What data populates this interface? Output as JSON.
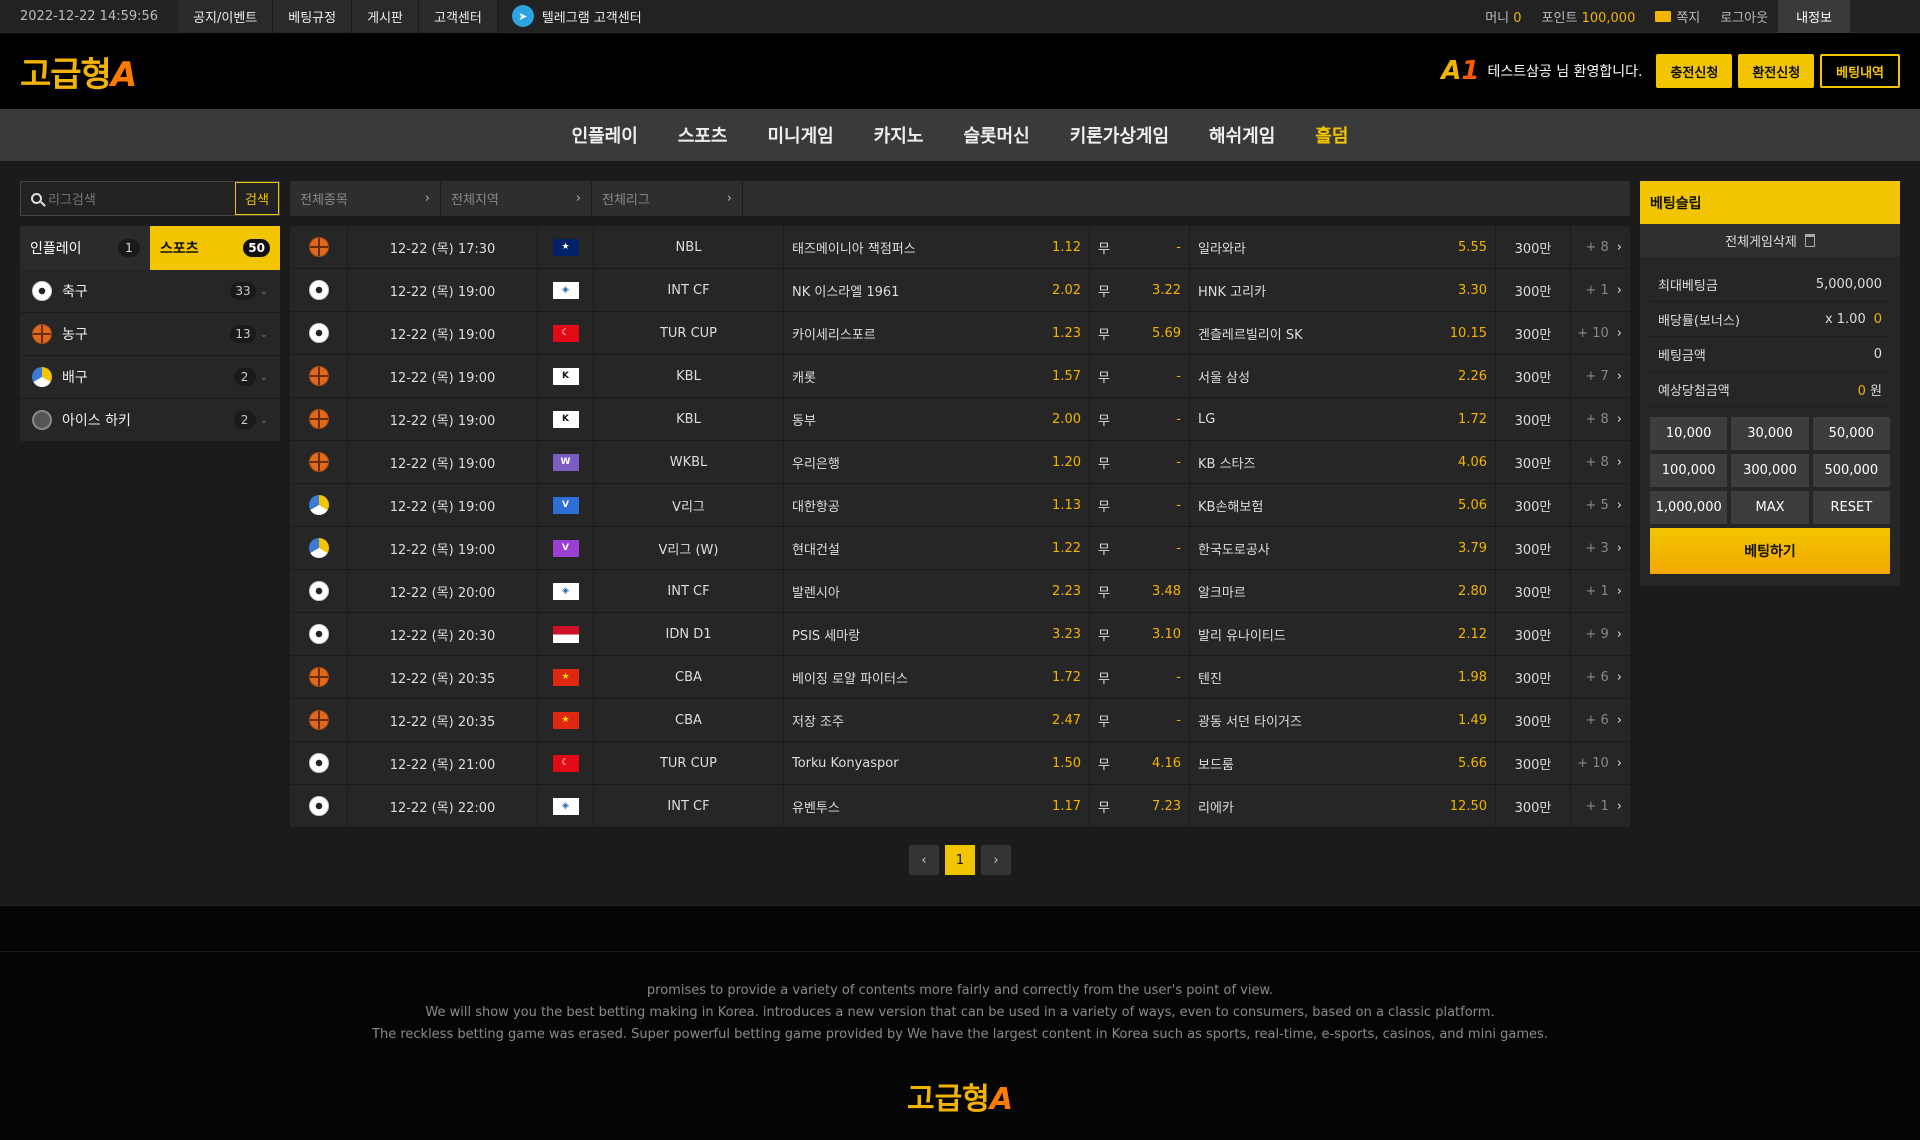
{
  "topbar": {
    "datetime": "2022-12-22 14:59:56",
    "nav": [
      "공지/이벤트",
      "베팅규정",
      "게시판",
      "고객센터"
    ],
    "telegram": "텔레그램 고객센터",
    "money_label": "머니",
    "money_value": "0",
    "point_label": "포인트",
    "point_value": "100,000",
    "message": "쪽지",
    "logout": "로그아웃",
    "myinfo": "내정보"
  },
  "header": {
    "logo_text": "고급형",
    "logo_letter": "A",
    "a1_text": "A",
    "a1_num": "1",
    "welcome": "테스트삼공 님 환영합니다.",
    "btn_deposit": "충전신청",
    "btn_withdraw": "환전신청",
    "btn_history": "베팅내역"
  },
  "mainnav": [
    "인플레이",
    "스포츠",
    "미니게임",
    "카지노",
    "슬롯머신",
    "키론가상게임",
    "해쉬게임",
    "홀덤"
  ],
  "sidebar": {
    "search_placeholder": "리그검색",
    "search_button": "검색",
    "tab_inplay": "인플레이",
    "tab_inplay_count": "1",
    "tab_sports": "스포츠",
    "tab_sports_count": "50",
    "sports": [
      {
        "name": "축구",
        "count": "33",
        "icon": "soccer"
      },
      {
        "name": "농구",
        "count": "13",
        "icon": "basket"
      },
      {
        "name": "배구",
        "count": "2",
        "icon": "volley"
      },
      {
        "name": "아이스 하키",
        "count": "2",
        "icon": "hockey"
      }
    ]
  },
  "filters": [
    "전체종목",
    "전체지역",
    "전체리그"
  ],
  "matches": [
    {
      "sport": "basket",
      "date": "12-22 (목) 17:30",
      "flag": "au",
      "league": "NBL",
      "home": "태즈메이니아 잭점퍼스",
      "home_odd": "1.12",
      "draw_label": "무",
      "draw_odd": "-",
      "away": "일라와라",
      "away_odd": "5.55",
      "limit": "300만",
      "more": "+ 8"
    },
    {
      "sport": "soccer",
      "date": "12-22 (목) 19:00",
      "flag": "world",
      "league": "INT CF",
      "home": "NK 이스라엘 1961",
      "home_odd": "2.02",
      "draw_label": "무",
      "draw_odd": "3.22",
      "away": "HNK 고리카",
      "away_odd": "3.30",
      "limit": "300만",
      "more": "+ 1"
    },
    {
      "sport": "soccer",
      "date": "12-22 (목) 19:00",
      "flag": "tr",
      "league": "TUR CUP",
      "home": "카이세리스포르",
      "home_odd": "1.23",
      "draw_label": "무",
      "draw_odd": "5.69",
      "away": "겐츨레르빌리이 SK",
      "away_odd": "10.15",
      "limit": "300만",
      "more": "+ 10"
    },
    {
      "sport": "basket",
      "date": "12-22 (목) 19:00",
      "flag": "kbl",
      "league": "KBL",
      "home": "캐롯",
      "home_odd": "1.57",
      "draw_label": "무",
      "draw_odd": "-",
      "away": "서울 삼성",
      "away_odd": "2.26",
      "limit": "300만",
      "more": "+ 7"
    },
    {
      "sport": "basket",
      "date": "12-22 (목) 19:00",
      "flag": "kbl",
      "league": "KBL",
      "home": "동부",
      "home_odd": "2.00",
      "draw_label": "무",
      "draw_odd": "-",
      "away": "LG",
      "away_odd": "1.72",
      "limit": "300만",
      "more": "+ 8"
    },
    {
      "sport": "basket",
      "date": "12-22 (목) 19:00",
      "flag": "wkbl",
      "league": "WKBL",
      "home": "우리은행",
      "home_odd": "1.20",
      "draw_label": "무",
      "draw_odd": "-",
      "away": "KB 스타즈",
      "away_odd": "4.06",
      "limit": "300만",
      "more": "+ 8"
    },
    {
      "sport": "volley",
      "date": "12-22 (목) 19:00",
      "flag": "vleague",
      "league": "V리그",
      "home": "대한항공",
      "home_odd": "1.13",
      "draw_label": "무",
      "draw_odd": "-",
      "away": "KB손해보험",
      "away_odd": "5.06",
      "limit": "300만",
      "more": "+ 5"
    },
    {
      "sport": "volley",
      "date": "12-22 (목) 19:00",
      "flag": "vleaguew",
      "league": "V리그 (W)",
      "home": "현대건설",
      "home_odd": "1.22",
      "draw_label": "무",
      "draw_odd": "-",
      "away": "한국도로공사",
      "away_odd": "3.79",
      "limit": "300만",
      "more": "+ 3"
    },
    {
      "sport": "soccer",
      "date": "12-22 (목) 20:00",
      "flag": "world",
      "league": "INT CF",
      "home": "발렌시아",
      "home_odd": "2.23",
      "draw_label": "무",
      "draw_odd": "3.48",
      "away": "알크마르",
      "away_odd": "2.80",
      "limit": "300만",
      "more": "+ 1"
    },
    {
      "sport": "soccer",
      "date": "12-22 (목) 20:30",
      "flag": "id",
      "league": "IDN D1",
      "home": "PSIS 세마랑",
      "home_odd": "3.23",
      "draw_label": "무",
      "draw_odd": "3.10",
      "away": "발리 유나이티드",
      "away_odd": "2.12",
      "limit": "300만",
      "more": "+ 9"
    },
    {
      "sport": "basket",
      "date": "12-22 (목) 20:35",
      "flag": "cn",
      "league": "CBA",
      "home": "베이징 로얄 파이터스",
      "home_odd": "1.72",
      "draw_label": "무",
      "draw_odd": "-",
      "away": "텐진",
      "away_odd": "1.98",
      "limit": "300만",
      "more": "+ 6"
    },
    {
      "sport": "basket",
      "date": "12-22 (목) 20:35",
      "flag": "cn",
      "league": "CBA",
      "home": "저장 조주",
      "home_odd": "2.47",
      "draw_label": "무",
      "draw_odd": "-",
      "away": "광동 서던 타이거즈",
      "away_odd": "1.49",
      "limit": "300만",
      "more": "+ 6"
    },
    {
      "sport": "soccer",
      "date": "12-22 (목) 21:00",
      "flag": "tr",
      "league": "TUR CUP",
      "home": "Torku Konyaspor",
      "home_odd": "1.50",
      "draw_label": "무",
      "draw_odd": "4.16",
      "away": "보드룸",
      "away_odd": "5.66",
      "limit": "300만",
      "more": "+ 10"
    },
    {
      "sport": "soccer",
      "date": "12-22 (목) 22:00",
      "flag": "world",
      "league": "INT CF",
      "home": "유벤투스",
      "home_odd": "1.17",
      "draw_label": "무",
      "draw_odd": "7.23",
      "away": "리에카",
      "away_odd": "12.50",
      "limit": "300만",
      "more": "+ 1"
    }
  ],
  "pager": {
    "prev": "‹",
    "current": "1",
    "next": "›"
  },
  "slip": {
    "title": "베팅슬립",
    "clear_all": "전체게임삭제",
    "max_bet_label": "최대베팅금",
    "max_bet_value": "5,000,000",
    "odds_label": "배당률(보너스)",
    "odds_value": "x 1.00",
    "odds_bonus": "0",
    "amount_label": "베팅금액",
    "amount_value": "0",
    "expected_label": "예상당첨금액",
    "expected_value": "0",
    "expected_unit": "원",
    "amounts": [
      "10,000",
      "30,000",
      "50,000",
      "100,000",
      "300,000",
      "500,000",
      "1,000,000",
      "MAX",
      "RESET"
    ],
    "bet_button": "베팅하기"
  },
  "footer": {
    "lines": [
      "promises to provide a variety of contents more fairly and correctly from the user's point of view.",
      "We will show you the best betting making in Korea. introduces a new version that can be used in a variety of ways, even to consumers, based on a classic platform.",
      "The reckless betting game was erased. Super powerful betting game provided by  We have the largest content in Korea such as sports, real-time, e-sports, casinos, and mini games."
    ],
    "logo_text": "고급형",
    "logo_letter": "A"
  },
  "colors": {
    "accent": "#f2c500",
    "odd": "#f2b400"
  }
}
